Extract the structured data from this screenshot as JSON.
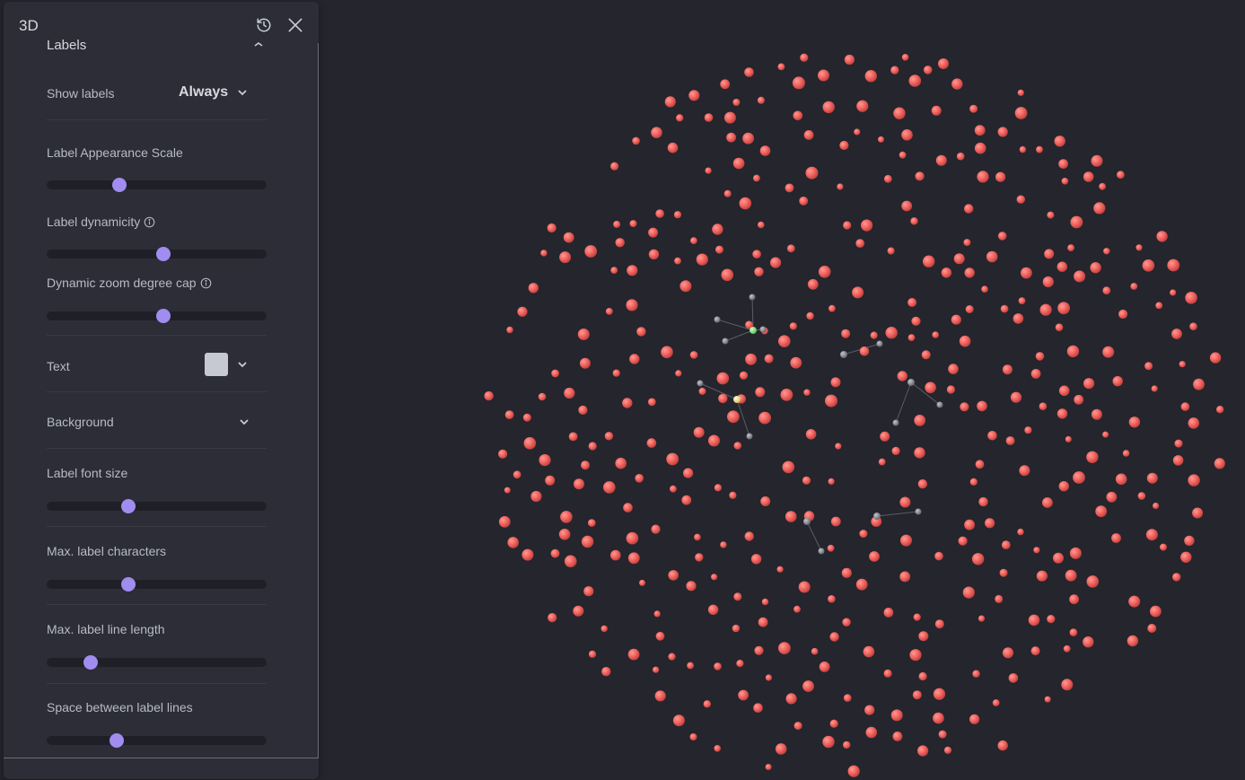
{
  "panel": {
    "title": "3D",
    "section_title": "Labels",
    "show_labels": {
      "label": "Show labels",
      "value": "Always"
    },
    "sliders": [
      {
        "label": "Label Appearance Scale",
        "value": 0.33,
        "info": false
      },
      {
        "label": "Label dynamicity",
        "value": 0.53,
        "info": true
      },
      {
        "label": "Dynamic zoom degree cap",
        "value": 0.53,
        "info": true
      },
      {
        "label": "Label font size",
        "value": 0.37,
        "info": false
      },
      {
        "label": "Max. label characters",
        "value": 0.37,
        "info": false
      },
      {
        "label": "Max. label line length",
        "value": 0.2,
        "info": false
      },
      {
        "label": "Space between label lines",
        "value": 0.32,
        "info": false
      }
    ],
    "text_color": {
      "label": "Text",
      "color": "#c6c9d2"
    },
    "background": {
      "label": "Background"
    }
  },
  "graph": {
    "node_color": "#f0605c",
    "gray_node_color": "#8a8d94",
    "highlight_green": "#7ddc6a",
    "highlight_yellow": "#f3e9a0"
  }
}
